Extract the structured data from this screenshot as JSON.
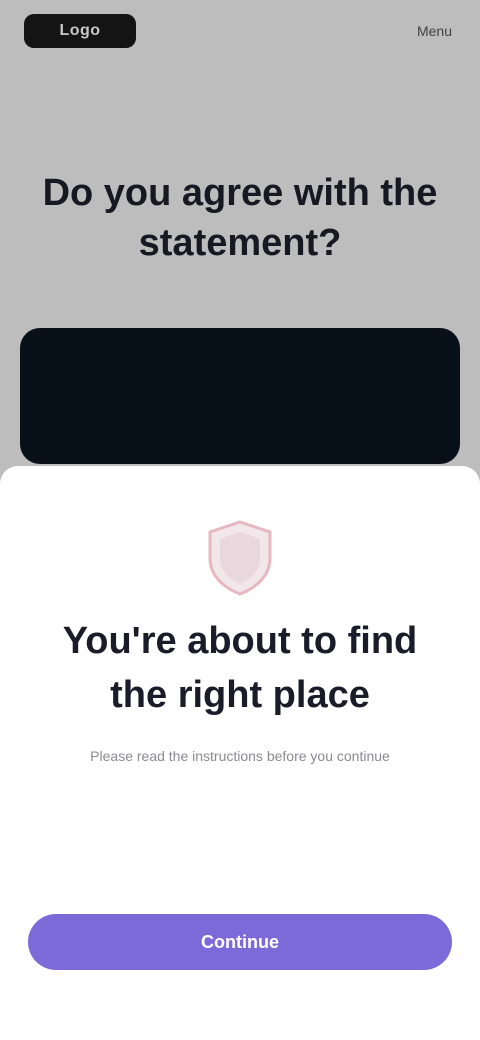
{
  "background": {
    "logo_text": "Logo",
    "menu_text": "Menu",
    "headline": "Do you agree with the statement?",
    "card_color": "#0b1620"
  },
  "sheet": {
    "icon": "shield-icon",
    "title": "You're about to find the right place",
    "subtitle": "Please read the instructions before you continue",
    "primary_button_label": "Continue",
    "accent_color": "#7b6ad8"
  }
}
